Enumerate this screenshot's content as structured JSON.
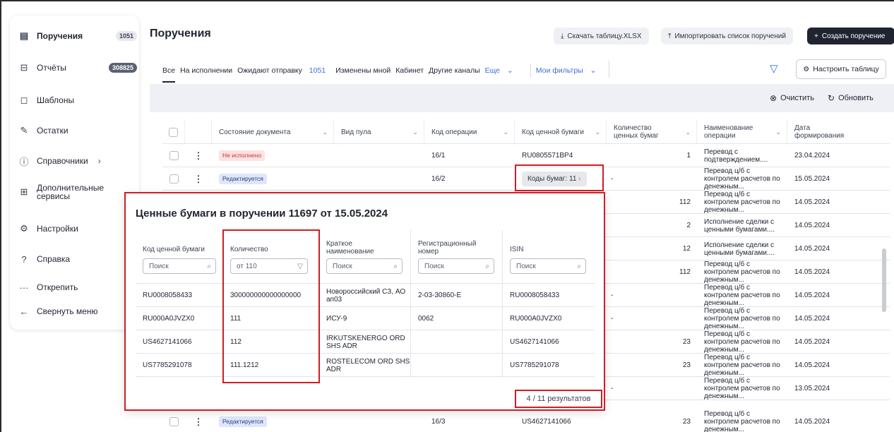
{
  "sidebar": {
    "items": [
      {
        "label": "Поручения",
        "badge": "1051",
        "icon": "document-icon"
      },
      {
        "label": "Отчёты",
        "badge": "308825",
        "icon": "report-icon"
      },
      {
        "label": "Шаблоны",
        "icon": "template-icon"
      },
      {
        "label": "Остатки",
        "icon": "edit-icon"
      },
      {
        "label": "Справочники",
        "icon": "info-icon"
      },
      {
        "label": "Дополнительные сервисы",
        "icon": "grid-icon"
      },
      {
        "label": "Настройки",
        "icon": "gear-icon"
      },
      {
        "label": "Справка",
        "icon": "help-icon"
      },
      {
        "label": "Открепить",
        "icon": "more-icon"
      },
      {
        "label": "Свернуть меню",
        "icon": "arrow-left-icon"
      }
    ]
  },
  "header": {
    "title": "Поручения",
    "download_label": "Скачать таблицу.XLSX",
    "import_label": "Импортировать список поручений",
    "create_label": "Создать поручение"
  },
  "tabs": {
    "all": "Все",
    "in_progress": "На исполнении",
    "awaiting": "Ожидают отправку",
    "awaiting_count": "1051",
    "changed": "Изменены мной",
    "cabinet": "Кабинет",
    "other": "Другие каналы",
    "more": "Еще",
    "my_filters": "Мои фильтры",
    "configure": "Настроить таблицу"
  },
  "toolbar": {
    "clear": "Очистить",
    "refresh": "Обновить"
  },
  "grid": {
    "headers": {
      "state": "Состояние документа",
      "pool": "Вид пула",
      "op_code": "Код операции",
      "sec_code": "Код ценной бумаги",
      "qty": "Количество ценных бумаг",
      "op_name": "Наименование операции",
      "date": "Дата формирования"
    },
    "rows": [
      {
        "state": "Не исполнено",
        "op_code": "16/1",
        "sec_code": "RU0805571BP4",
        "qty": "1",
        "op_name": "Перевод с подтверждением....",
        "date": "23.04.2024"
      },
      {
        "state": "Редактируется",
        "op_code": "16/2",
        "sec_code": "Коды бумаг: 11",
        "qty": "-",
        "op_name": "Перевод ц/б с контролем расчетов по денежным...",
        "date": "15.05.2024"
      },
      {
        "qty": "112",
        "op_name": "Перевод ц/б с контролем расчетов по денежным...",
        "date": "14.05.2024"
      },
      {
        "qty": "2",
        "op_name": "Исполнение сделки с ценными бумагами....",
        "date": "14.05.2024"
      },
      {
        "qty": "12",
        "op_name": "Исполнение сделки с ценными бумагами....",
        "date": "14.05.2024"
      },
      {
        "qty": "112",
        "op_name": "Перевод ц/б с контролем расчетов по денежным...",
        "date": "14.05.2024"
      },
      {
        "qty": "-",
        "op_name": "Перевод ц/б с контролем расчетов по денежным...",
        "date": "14.05.2024"
      },
      {
        "qty": "-",
        "op_name": "Перевод ц/б с контролем расчетов по денежным...",
        "date": "14.05.2024"
      },
      {
        "qty": "23",
        "op_name": "Перевод ц/б с контролем расчетов по денежным...",
        "date": "14.05.2024"
      },
      {
        "qty": "23",
        "op_name": "Перевод ц/б с контролем расчетов по денежным...",
        "date": "14.05.2024"
      },
      {
        "qty": "-",
        "op_name": "Перевод ц/б с контролем расчетов по денежным...",
        "date": "13.05.2024"
      },
      {
        "state": "Редактируется",
        "op_code": "16/3",
        "sec_code": "US4627141066",
        "qty": "23",
        "op_name": "Перевод ц/б с контролем расчетов по денежным...",
        "date": "14.05.2024"
      }
    ]
  },
  "popup": {
    "title": "Ценные бумаги в поручении 11697 от 15.05.2024",
    "headers": {
      "code": "Код ценной бумаги",
      "qty": "Количество",
      "short": "Краткое наименование",
      "reg": "Регистрационный номер",
      "isin": "ISIN"
    },
    "search_placeholder": "Поиск",
    "qty_filter": "от 110",
    "rows": [
      {
        "code": "RU0008058433",
        "qty": "300000000000000000",
        "short": "Новороссийский СЗ, АО ап03",
        "reg": "2-03-30860-E",
        "isin": "RU0008058433"
      },
      {
        "code": "RU000A0JVZX0",
        "qty": "111",
        "short": "ИСУ-9",
        "reg": "0062",
        "isin": "RU000A0JVZX0"
      },
      {
        "code": "US4627141066",
        "qty": "112",
        "short": "IRKUTSKENERGO ORD SHS ADR",
        "reg": "",
        "isin": "US4627141066"
      },
      {
        "code": "US7785291078",
        "qty": "111.1212",
        "short": "ROSTELECOM ORD SHS ADR",
        "reg": "",
        "isin": "US7785291078"
      }
    ],
    "results": "4 / 11 результатов"
  },
  "colors": {
    "accent": "#3b6fd8",
    "highlight": "#d21c24",
    "dark": "#1f2430"
  }
}
